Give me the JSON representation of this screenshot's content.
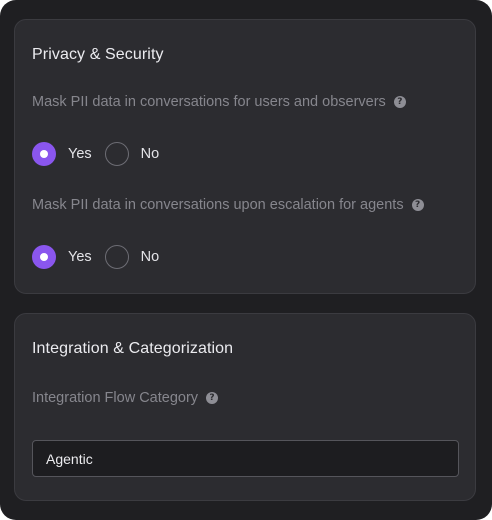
{
  "privacy": {
    "title": "Privacy & Security",
    "mask_users": {
      "label": "Mask PII data in conversations for users and observers",
      "selected": "Yes",
      "options": [
        "Yes",
        "No"
      ]
    },
    "mask_agents": {
      "label": "Mask PII data in conversations upon escalation for agents",
      "selected": "Yes",
      "options": [
        "Yes",
        "No"
      ]
    }
  },
  "integration": {
    "title": "Integration & Categorization",
    "flow_category": {
      "label": "Integration Flow Category",
      "value": "Agentic"
    }
  },
  "colors": {
    "accent": "#8a56ee",
    "panel": "#2c2c30",
    "background": "#1f1f22"
  },
  "icons": {
    "help": "question-circle-icon"
  }
}
